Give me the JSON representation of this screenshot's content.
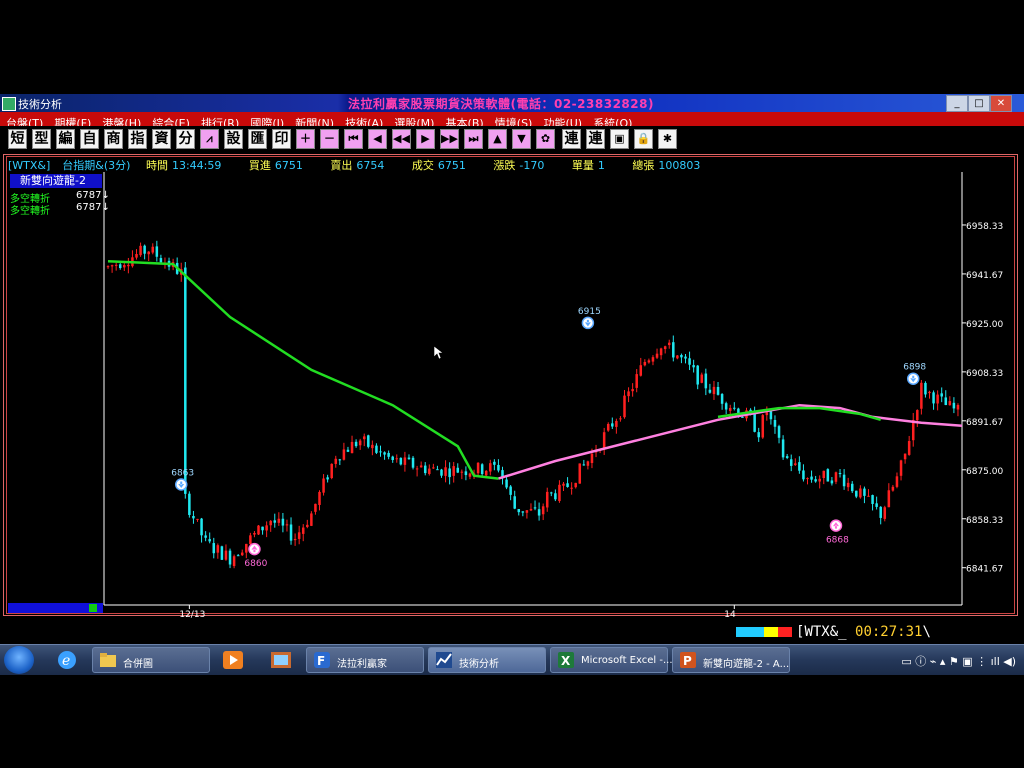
{
  "window": {
    "title": "技術分析",
    "center_title": "法拉利贏家股票期貨決策軟體(電話：02-23832828)",
    "controls": [
      "_",
      "□",
      "✕"
    ]
  },
  "menu": [
    "台盤(T)",
    "期權(F)",
    "港盤(H)",
    "綜合(E)",
    "排行(R)",
    "國際(I)",
    "新聞(N)",
    "技術(A)",
    "選股(M)",
    "基本(B)",
    "情境(S)",
    "功能(U)",
    "系統(O)"
  ],
  "toolbar": {
    "text_buttons": [
      "短",
      "型",
      "編",
      "自",
      "商",
      "指",
      "資",
      "分"
    ],
    "text_buttons2": [
      "設",
      "匯",
      "印"
    ],
    "tail_buttons": [
      "連",
      "連"
    ]
  },
  "info_bar": {
    "symbol": "[WTX&]",
    "name": "台指期&(3分)",
    "time_label": "時間",
    "time": "13:44:59",
    "bid_label": "買進",
    "bid": "6751",
    "ask_label": "賣出",
    "ask": "6754",
    "deal_label": "成交",
    "deal": "6751",
    "change_label": "漲跌",
    "change": "-170",
    "vol_label": "單量",
    "vol": "1",
    "total_label": "總張",
    "total": "100803"
  },
  "indicator": {
    "title": "新雙向遊龍-2",
    "lines": [
      {
        "label": "多空轉折",
        "value": "6787↓"
      },
      {
        "label": "多空轉折",
        "value": "6787↓"
      }
    ]
  },
  "chart_data": {
    "type": "candlestick",
    "x_labels": [
      {
        "label": "12/13",
        "index": 20
      },
      {
        "label": "14",
        "index": 154
      }
    ],
    "y_ticks": [
      6958.33,
      6941.67,
      6925.0,
      6908.33,
      6891.67,
      6875.0,
      6858.33,
      6841.67
    ],
    "ylim": [
      6830,
      6975
    ],
    "candle_count": 210,
    "path": [
      [
        0,
        6944
      ],
      [
        10,
        6950
      ],
      [
        18,
        6942
      ],
      [
        19,
        6865
      ],
      [
        24,
        6850
      ],
      [
        30,
        6845
      ],
      [
        40,
        6858
      ],
      [
        46,
        6852
      ],
      [
        50,
        6860
      ],
      [
        56,
        6880
      ],
      [
        62,
        6885
      ],
      [
        70,
        6878
      ],
      [
        80,
        6875
      ],
      [
        90,
        6875
      ],
      [
        96,
        6876
      ],
      [
        100,
        6862
      ],
      [
        106,
        6860
      ],
      [
        108,
        6866
      ],
      [
        112,
        6868
      ],
      [
        118,
        6878
      ],
      [
        126,
        6895
      ],
      [
        132,
        6912
      ],
      [
        136,
        6918
      ],
      [
        140,
        6914
      ],
      [
        146,
        6905
      ],
      [
        152,
        6898
      ],
      [
        158,
        6892
      ],
      [
        160,
        6888
      ],
      [
        162,
        6895
      ],
      [
        166,
        6880
      ],
      [
        172,
        6872
      ],
      [
        180,
        6873
      ],
      [
        186,
        6865
      ],
      [
        190,
        6860
      ],
      [
        194,
        6872
      ],
      [
        196,
        6880
      ],
      [
        198,
        6892
      ],
      [
        200,
        6903
      ],
      [
        206,
        6897
      ],
      [
        210,
        6894
      ]
    ],
    "ma_green": [
      [
        0,
        6946
      ],
      [
        16,
        6945
      ],
      [
        30,
        6927
      ],
      [
        50,
        6909
      ],
      [
        70,
        6897
      ],
      [
        86,
        6883
      ],
      [
        90,
        6873
      ],
      [
        96,
        6872
      ]
    ],
    "ma_pink": [
      [
        96,
        6872
      ],
      [
        110,
        6878
      ],
      [
        130,
        6885
      ],
      [
        150,
        6892
      ],
      [
        170,
        6897
      ],
      [
        180,
        6896
      ],
      [
        188,
        6893
      ],
      [
        200,
        6891
      ],
      [
        210,
        6890
      ]
    ],
    "ma_green2": [
      [
        150,
        6893
      ],
      [
        165,
        6896
      ],
      [
        175,
        6896
      ],
      [
        185,
        6894
      ],
      [
        190,
        6892
      ]
    ],
    "markers": [
      {
        "label": "6863",
        "index": 18,
        "value": 6870,
        "kind": "down"
      },
      {
        "label": "6860",
        "index": 36,
        "value": 6848,
        "kind": "up"
      },
      {
        "label": "6915",
        "index": 118,
        "value": 6925,
        "kind": "down"
      },
      {
        "label": "6868",
        "index": 179,
        "value": 6856,
        "kind": "up"
      },
      {
        "label": "6898",
        "index": 198,
        "value": 6906,
        "kind": "down"
      }
    ],
    "colors": {
      "up": "#ff2020",
      "down": "#20e8f0",
      "ma_green": "#22dd22",
      "ma_pink": "#ff80e0",
      "marker_up": "#ff6ad8",
      "marker_down": "#5aa8ff",
      "axis": "#ffffff"
    }
  },
  "ticker": {
    "symbol": "WTX&",
    "clock": "00:27:31"
  },
  "taskbar": {
    "tasks": [
      {
        "label": "合併圖",
        "icon": "folder-icon"
      },
      {
        "label": "法拉利贏家",
        "icon": "app-icon"
      },
      {
        "label": "技術分析",
        "icon": "chart-icon"
      },
      {
        "label": "Microsoft Excel -...",
        "icon": "excel-icon"
      },
      {
        "label": "新雙向遊龍-2 - A...",
        "icon": "powerpoint-icon"
      }
    ]
  }
}
